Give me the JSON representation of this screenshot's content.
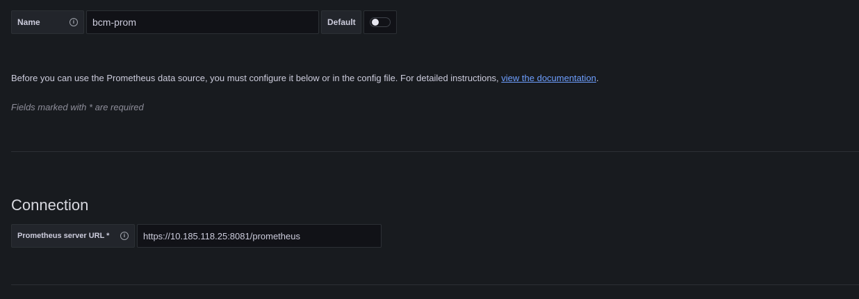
{
  "basic": {
    "name_label": "Name",
    "name_value": "bcm-prom",
    "default_label": "Default",
    "default_enabled": false
  },
  "intro": {
    "text": "Before you can use the Prometheus data source, you must configure it below or in the config file. For detailed instructions, ",
    "link_text": "view the documentation",
    "suffix": ".",
    "required_note": "Fields marked with * are required"
  },
  "connection": {
    "title": "Connection",
    "url_label": "Prometheus server URL *",
    "url_value": "https://10.185.118.25:8081/prometheus"
  },
  "icons": {
    "info": "info-circle-icon",
    "info_glyph": "i"
  },
  "colors": {
    "background": "#181b1f",
    "link": "#6e9fff",
    "text": "#ccccdc"
  }
}
